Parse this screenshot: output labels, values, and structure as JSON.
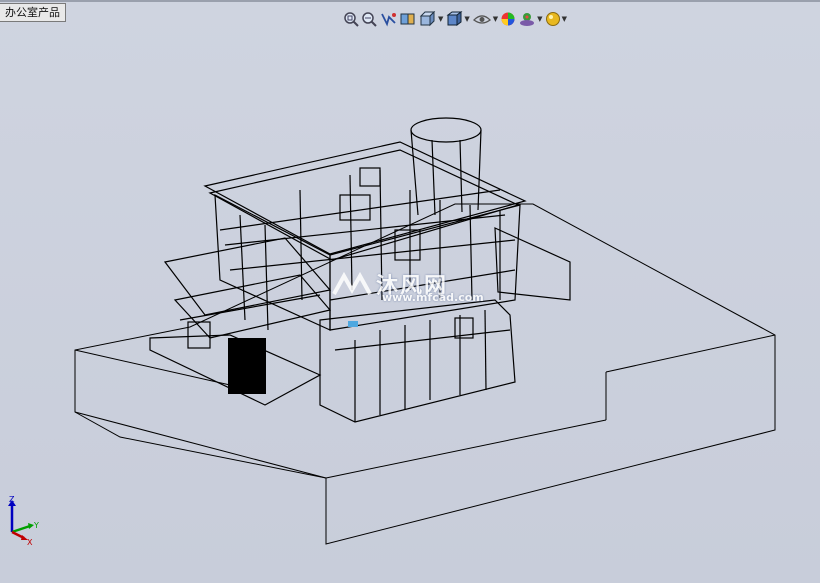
{
  "document_tab": {
    "title": "办公室产品"
  },
  "toolbar": {
    "buttons": [
      {
        "icon": "zoom-to-fit-icon",
        "dropdown": false
      },
      {
        "icon": "zoom-to-area-icon",
        "dropdown": false
      },
      {
        "icon": "previous-view-icon",
        "dropdown": false
      },
      {
        "icon": "section-view-icon",
        "dropdown": false
      },
      {
        "icon": "view-orientation-icon",
        "dropdown": true
      },
      {
        "icon": "display-style-icon",
        "dropdown": true
      },
      {
        "icon": "hide-show-items-icon",
        "dropdown": true
      },
      {
        "icon": "edit-appearance-icon",
        "dropdown": false
      },
      {
        "icon": "apply-scene-icon",
        "dropdown": true
      },
      {
        "icon": "view-settings-icon",
        "dropdown": true
      }
    ]
  },
  "watermark": {
    "title": "沐风网",
    "url": "www.mfcad.com"
  },
  "triad": {
    "x_label": "X",
    "y_label": "Y",
    "z_label": "Z"
  },
  "colors": {
    "background": "#c9cedb",
    "wireframe": "#000000",
    "triad_x": "#c00000",
    "triad_y": "#00a000",
    "triad_z": "#0000c0"
  }
}
